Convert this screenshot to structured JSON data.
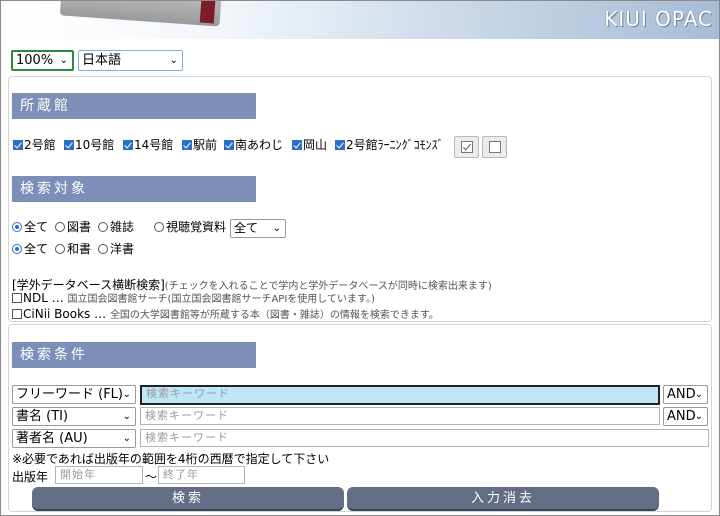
{
  "header": {
    "logo": "KIUI OPAC"
  },
  "top_selects": {
    "zoom": "100%",
    "language": "日本語"
  },
  "holdings": {
    "title": "所蔵館",
    "libraries": [
      {
        "label": "2号館",
        "checked": true
      },
      {
        "label": "10号館",
        "checked": true
      },
      {
        "label": "14号館",
        "checked": true
      },
      {
        "label": "駅前",
        "checked": true
      },
      {
        "label": "南あわじ",
        "checked": true
      },
      {
        "label": "岡山",
        "checked": true
      },
      {
        "label": "2号館ﾗｰﾆﾝｸﾞｺﾓﾝｽﾞ",
        "checked": true
      }
    ],
    "select_all_icon": "check-all-icon",
    "clear_all_icon": "uncheck-all-icon"
  },
  "target": {
    "title": "検索対象",
    "row1": [
      {
        "label": "全て",
        "selected": true
      },
      {
        "label": "図書",
        "selected": false
      },
      {
        "label": "雑誌",
        "selected": false
      },
      {
        "label": "視聴覚資料",
        "selected": false
      }
    ],
    "av_select": "全て",
    "row2": [
      {
        "label": "全て",
        "selected": true
      },
      {
        "label": "和書",
        "selected": false
      },
      {
        "label": "洋書",
        "selected": false
      }
    ],
    "external_heading": "[学外データベース横断検索]",
    "external_note": "(チェックを入れることで学内と学外データベースが同時に検索出来ます)",
    "ndl_label": "NDL …",
    "ndl_desc": "国立国会図書館サーチ(国立国会図書館サーチAPIを使用しています。)",
    "cinii_label": "CiNii Books …",
    "cinii_desc": "全国の大学図書館等が所蔵する本（図書・雑誌）の情報を検索できます。"
  },
  "conditions": {
    "title": "検索条件",
    "rows": [
      {
        "field": "フリーワード (FL)",
        "placeholder": "検索キーワード",
        "op": "AND"
      },
      {
        "field": "書名 (TI)",
        "placeholder": "検索キーワード",
        "op": "AND"
      },
      {
        "field": "著者名 (AU)",
        "placeholder": "検索キーワード",
        "op": ""
      }
    ],
    "year_note": "※必要であれば出版年の範囲を4桁の西暦で指定して下さい",
    "year_label": "出版年",
    "year_start_placeholder": "開始年",
    "year_sep": "〜",
    "year_end_placeholder": "終了年",
    "search_button": "検索",
    "clear_button": "入力消去"
  }
}
